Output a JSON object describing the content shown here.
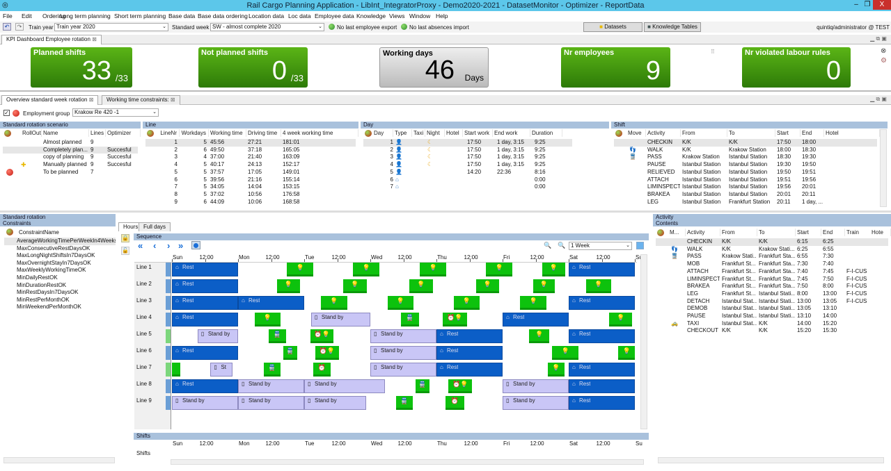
{
  "window": {
    "title": "Rail Cargo Planning Application - LibInt_IntegratorProxy - Demo2020-2021 - DatasetMonitor - Optimizer - ReportData",
    "minimize": "–",
    "restore": "❐",
    "close": "X"
  },
  "menu": [
    "File",
    "Edit",
    "Ordering",
    "Long term planning",
    "Short term planning",
    "Base data",
    "Base data ordering",
    "Location data",
    "Loc data",
    "Employee data",
    "Knowledge",
    "Views",
    "Window",
    "Help"
  ],
  "toolbar": {
    "train_year_label": "Train year",
    "train_year_value": "Train year 2020",
    "standard_week_label": "Standard week",
    "standard_week_value": "SW - almost complete 2020",
    "employee_export": "No last employee export",
    "absences_import": "No last absences import",
    "datasets": "Datasets",
    "knowledge_tables": "Knowledge Tables",
    "user": "quintiq/administrator @ TEST"
  },
  "top_tab": "KPI Dashboard Employee rotation",
  "kpis": [
    {
      "label": "Planned shifts",
      "value": "33",
      "sub": "/33"
    },
    {
      "label": "Not planned shifts",
      "value": "0",
      "sub": "/33"
    },
    {
      "label": "Working days",
      "value": "46",
      "sub": "Days"
    },
    {
      "label": "Nr employees",
      "value": "9",
      "sub": ""
    },
    {
      "label": "Nr violated labour rules",
      "value": "0",
      "sub": ""
    }
  ],
  "tabs": [
    "Overview standard week rotation",
    "Working time constraints:"
  ],
  "employment_group": {
    "label": "Employment group",
    "value": "Krakow Re 420 -1",
    "checked": true
  },
  "scenario": {
    "title": "Standard rotation scenario",
    "columns": [
      "RollOut",
      "Name",
      "Lines",
      "Optimizer"
    ],
    "rows": [
      [
        "",
        "Almost planned",
        "9",
        ""
      ],
      [
        "",
        "Completely plan...",
        "9",
        "Succesful"
      ],
      [
        "",
        "copy of planning",
        "9",
        "Succesful"
      ],
      [
        "",
        "Manually planned",
        "9",
        "Succesful"
      ],
      [
        "",
        "To be planned",
        "7",
        ""
      ]
    ]
  },
  "line": {
    "title": "Line",
    "columns": [
      "LineNr",
      "Workdays",
      "Working time",
      "Driving time",
      "4 week working time"
    ],
    "rows": [
      [
        "1",
        "5",
        "45:56",
        "27:21",
        "181:01"
      ],
      [
        "2",
        "6",
        "49:50",
        "37:18",
        "165:05"
      ],
      [
        "3",
        "4",
        "37:00",
        "21:40",
        "163:09"
      ],
      [
        "4",
        "5",
        "40:17",
        "24:13",
        "152:17"
      ],
      [
        "5",
        "5",
        "37:57",
        "17:05",
        "149:01"
      ],
      [
        "6",
        "5",
        "39:56",
        "21:16",
        "155:14"
      ],
      [
        "7",
        "5",
        "34:05",
        "14:04",
        "153:15"
      ],
      [
        "8",
        "5",
        "37:02",
        "10:56",
        "176:58"
      ],
      [
        "9",
        "6",
        "44:09",
        "10:06",
        "168:58"
      ]
    ]
  },
  "day": {
    "title": "Day",
    "columns": [
      "Day",
      "Type",
      "Taxi",
      "Night",
      "Hotel",
      "Start work",
      "End  work",
      "Duration"
    ],
    "rows": [
      [
        "1",
        "work",
        "",
        "night",
        "",
        "17:50",
        "1 day, 3:15",
        "9:25"
      ],
      [
        "2",
        "work",
        "",
        "night",
        "",
        "17:50",
        "1 day, 3:15",
        "9:25"
      ],
      [
        "3",
        "work",
        "",
        "night",
        "",
        "17:50",
        "1 day, 3:15",
        "9:25"
      ],
      [
        "4",
        "work",
        "",
        "night",
        "",
        "17:50",
        "1 day, 3:15",
        "9:25"
      ],
      [
        "5",
        "work",
        "",
        "",
        "",
        "14:20",
        "22:36",
        "8:16"
      ],
      [
        "6",
        "home",
        "",
        "",
        "",
        "",
        "",
        "0:00"
      ],
      [
        "7",
        "home",
        "",
        "",
        "",
        "",
        "",
        "0:00"
      ]
    ]
  },
  "shift": {
    "title": "Shift",
    "columns": [
      "Move",
      "Activity",
      "From",
      "To",
      "Start",
      "End",
      "Hotel"
    ],
    "rows": [
      [
        "",
        "CHECKIN",
        "K/K",
        "K/K",
        "17:50",
        "18:00",
        ""
      ],
      [
        "walk",
        "WALK",
        "K/K",
        "Krakow Station",
        "18:00",
        "18:30",
        ""
      ],
      [
        "train",
        "PASS",
        "Krakow Station",
        "Istanbul Station",
        "18:30",
        "19:30",
        ""
      ],
      [
        "",
        "PAUSE",
        "Istanbul Station",
        "Istanbul Station",
        "19:30",
        "19:50",
        ""
      ],
      [
        "",
        "RELIEVED",
        "Istanbul Station",
        "Istanbul Station",
        "19:50",
        "19:51",
        ""
      ],
      [
        "",
        "ATTACH",
        "Istanbul Station",
        "Istanbul Station",
        "19:51",
        "19:56",
        ""
      ],
      [
        "",
        "LIMINSPECT",
        "Istanbul Station",
        "Istanbul Station",
        "19:56",
        "20:01",
        ""
      ],
      [
        "",
        "BRAKEA",
        "Istanbul Station",
        "Istanbul Station",
        "20:01",
        "20:11",
        ""
      ],
      [
        "",
        "LEG",
        "Istanbul Station",
        "Frankfurt Station",
        "20:11",
        "1 day, ...",
        ""
      ]
    ]
  },
  "constraints": {
    "title1": "Standard rotation",
    "title2": "Constraints",
    "column": "ConstraintName",
    "rows": [
      "AverageWorkingTimePerWeekIn4Weeks",
      "MaxConsecutiveRestDaysOK",
      "MaxLongNightShiftsIn7DaysOK",
      "MaxOvernightStayIn7DaysOK",
      "MaxWeeklyWorkingTimeOK",
      "MinDailyRestOK",
      "MinDurationRestOK",
      "MinRestDaysIn7DaysOK",
      "MinRestPerMonthOK",
      "MinWeekendPerMonthOK"
    ]
  },
  "gantt": {
    "tabs": [
      "Hours",
      "Full days"
    ],
    "title": "Sequence",
    "zoom": "1 Week",
    "shifts_title": "Shifts",
    "shifts_row": "Shifts",
    "axis": [
      "Sun",
      "12:00",
      "Mon",
      "12:00",
      "Tue",
      "12:00",
      "Wed",
      "12:00",
      "Thu",
      "12:00",
      "Fri",
      "12:00",
      "Sat",
      "12:00",
      "Su"
    ],
    "lines": [
      {
        "name": "Line 1",
        "bars": [
          [
            "rest",
            0,
            24,
            "Rest"
          ],
          [
            "green",
            41.7,
            51.3,
            "person"
          ],
          [
            "green",
            65.7,
            75.3,
            "person"
          ],
          [
            "green",
            90,
            99.5,
            "person"
          ],
          [
            "green",
            114,
            123.5,
            "person"
          ],
          [
            "green",
            134.4,
            142.7,
            "person"
          ],
          [
            "rest",
            144,
            168,
            "Rest"
          ]
        ]
      },
      {
        "name": "Line 2",
        "bars": [
          [
            "rest",
            0,
            24,
            "Rest"
          ],
          [
            "green",
            38.1,
            46.5,
            "person"
          ],
          [
            "green",
            62.1,
            70.7,
            "person"
          ],
          [
            "green",
            86.2,
            94.7,
            "person"
          ],
          [
            "green",
            110.4,
            118.7,
            "person"
          ],
          [
            "green",
            131,
            139,
            "person"
          ],
          [
            "green",
            150.3,
            159.4,
            "person"
          ]
        ]
      },
      {
        "name": "Line 3",
        "bars": [
          [
            "rest",
            0,
            24,
            "Rest"
          ],
          [
            "rest",
            24,
            48,
            "Rest"
          ],
          [
            "green",
            54,
            63.7,
            "person"
          ],
          [
            "green",
            78.3,
            87.7,
            "person"
          ],
          [
            "green",
            102.3,
            111.7,
            "person"
          ],
          [
            "green",
            126.3,
            136,
            "person"
          ],
          [
            "rest",
            144,
            168,
            "Rest"
          ]
        ]
      },
      {
        "name": "Line 4",
        "bars": [
          [
            "rest",
            0,
            24,
            "Rest"
          ],
          [
            "green",
            30,
            39.4,
            "person"
          ],
          [
            "standby",
            50.5,
            72,
            "Stand by"
          ],
          [
            "green",
            83,
            89.8,
            "train"
          ],
          [
            "green",
            98.3,
            107,
            "alarm-person"
          ],
          [
            "rest",
            120,
            144,
            "Rest"
          ],
          [
            "green",
            158.7,
            167,
            "person"
          ]
        ]
      },
      {
        "name": "Line 5",
        "bars": [
          [
            "standby",
            9.3,
            24,
            "Stand by"
          ],
          [
            "green",
            35,
            41.5,
            "train"
          ],
          [
            "green",
            50.3,
            58.6,
            "alarm-person"
          ],
          [
            "standby",
            72,
            96,
            "Stand by"
          ],
          [
            "rest",
            96,
            120,
            "Rest"
          ],
          [
            "green",
            129.6,
            137,
            "person"
          ],
          [
            "rest",
            144,
            168,
            "Rest"
          ]
        ]
      },
      {
        "name": "Line 6",
        "bars": [
          [
            "rest",
            0,
            24,
            "Rest"
          ],
          [
            "green",
            40.4,
            45.5,
            "train"
          ],
          [
            "green",
            52,
            60.6,
            "alarm-person"
          ],
          [
            "standby",
            72,
            96,
            "Stand by"
          ],
          [
            "rest",
            96,
            120,
            "Rest"
          ],
          [
            "green",
            138,
            147.5,
            "person"
          ],
          [
            "green",
            162,
            168,
            "person"
          ]
        ]
      },
      {
        "name": "Line 7",
        "bars": [
          [
            "green",
            0,
            3,
            ""
          ],
          [
            "standby",
            14,
            22,
            "St"
          ],
          [
            "green",
            33.3,
            39.4,
            "train"
          ],
          [
            "green",
            51.3,
            57.6,
            "alarm"
          ],
          [
            "standby",
            72,
            96,
            "Stand by"
          ],
          [
            "rest",
            96,
            120,
            "Rest"
          ],
          [
            "green",
            136.4,
            142.5,
            "person"
          ],
          [
            "rest",
            144,
            168,
            "Rest"
          ]
        ]
      },
      {
        "name": "Line 8",
        "bars": [
          [
            "rest",
            0,
            24,
            "Rest"
          ],
          [
            "standby",
            24,
            48,
            "Stand by"
          ],
          [
            "standby",
            48,
            77.3,
            "Stand by"
          ],
          [
            "green",
            88.4,
            93.5,
            "train"
          ],
          [
            "green",
            100.3,
            109,
            "alarm-person"
          ],
          [
            "standby",
            120,
            144,
            "Stand by"
          ],
          [
            "rest",
            144,
            168,
            "Rest"
          ]
        ]
      },
      {
        "name": "Line 9",
        "bars": [
          [
            "standby",
            0,
            24,
            "Stand by"
          ],
          [
            "standby",
            24,
            48,
            "Stand by"
          ],
          [
            "standby",
            48,
            70.5,
            "Stand by"
          ],
          [
            "green",
            81.3,
            87.4,
            "train"
          ],
          [
            "green",
            99.3,
            106,
            "alarm"
          ],
          [
            "standby",
            120,
            144,
            "Stand by"
          ],
          [
            "rest",
            144,
            168,
            "Rest"
          ]
        ]
      }
    ]
  },
  "activity": {
    "title1": "Activity",
    "title2": "Contents",
    "columns": [
      "M...",
      "Activity",
      "From",
      "To",
      "Start",
      "End",
      "Train",
      "Hote"
    ],
    "rows": [
      [
        "",
        "CHECKIN",
        "K/K",
        "K/K",
        "6:15",
        "6:25",
        ""
      ],
      [
        "walk",
        "WALK",
        "K/K",
        "Krakow Stati...",
        "6:25",
        "6:55",
        ""
      ],
      [
        "train",
        "PASS",
        "Krakow Stati...",
        "Frankfurt Sta...",
        "6:55",
        "7:30",
        ""
      ],
      [
        "",
        "MOB",
        "Frankfurt St...",
        "Frankfurt Sta...",
        "7:30",
        "7:40",
        ""
      ],
      [
        "",
        "ATTACH",
        "Frankfurt St...",
        "Frankfurt Sta...",
        "7:40",
        "7:45",
        "F-I-CUS"
      ],
      [
        "",
        "LIMINSPECT",
        "Frankfurt St...",
        "Frankfurt Sta...",
        "7:45",
        "7:50",
        "F-I-CUS"
      ],
      [
        "",
        "BRAKEA",
        "Frankfurt St...",
        "Frankfurt Sta...",
        "7:50",
        "8:00",
        "F-I-CUS"
      ],
      [
        "",
        "LEG",
        "Frankfurt St...",
        "Istanbul Stati...",
        "8:00",
        "13:00",
        "F-I-CUS"
      ],
      [
        "",
        "DETACH",
        "Istanbul Stat...",
        "Istanbul Stati...",
        "13:00",
        "13:05",
        "F-I-CUS"
      ],
      [
        "",
        "DEMOB",
        "Istanbul Stat...",
        "Istanbul Stati...",
        "13:05",
        "13:10",
        ""
      ],
      [
        "",
        "PAUSE",
        "Istanbul Stat...",
        "Istanbul Stati...",
        "13:10",
        "14:00",
        ""
      ],
      [
        "taxi",
        "TAXI",
        "Istanbul Stat...",
        "K/K",
        "14:00",
        "15:20",
        ""
      ],
      [
        "",
        "CHECKOUT",
        "K/K",
        "K/K",
        "15:20",
        "15:30",
        ""
      ]
    ]
  },
  "colors": {
    "kpi_green": "#3f9a0e",
    "rest": "#0b5ec7",
    "standby": "#c9c6f6",
    "shift": "#0dc20d",
    "panel_header": "#a9c1dc",
    "titlebar": "#5cc7ea"
  }
}
